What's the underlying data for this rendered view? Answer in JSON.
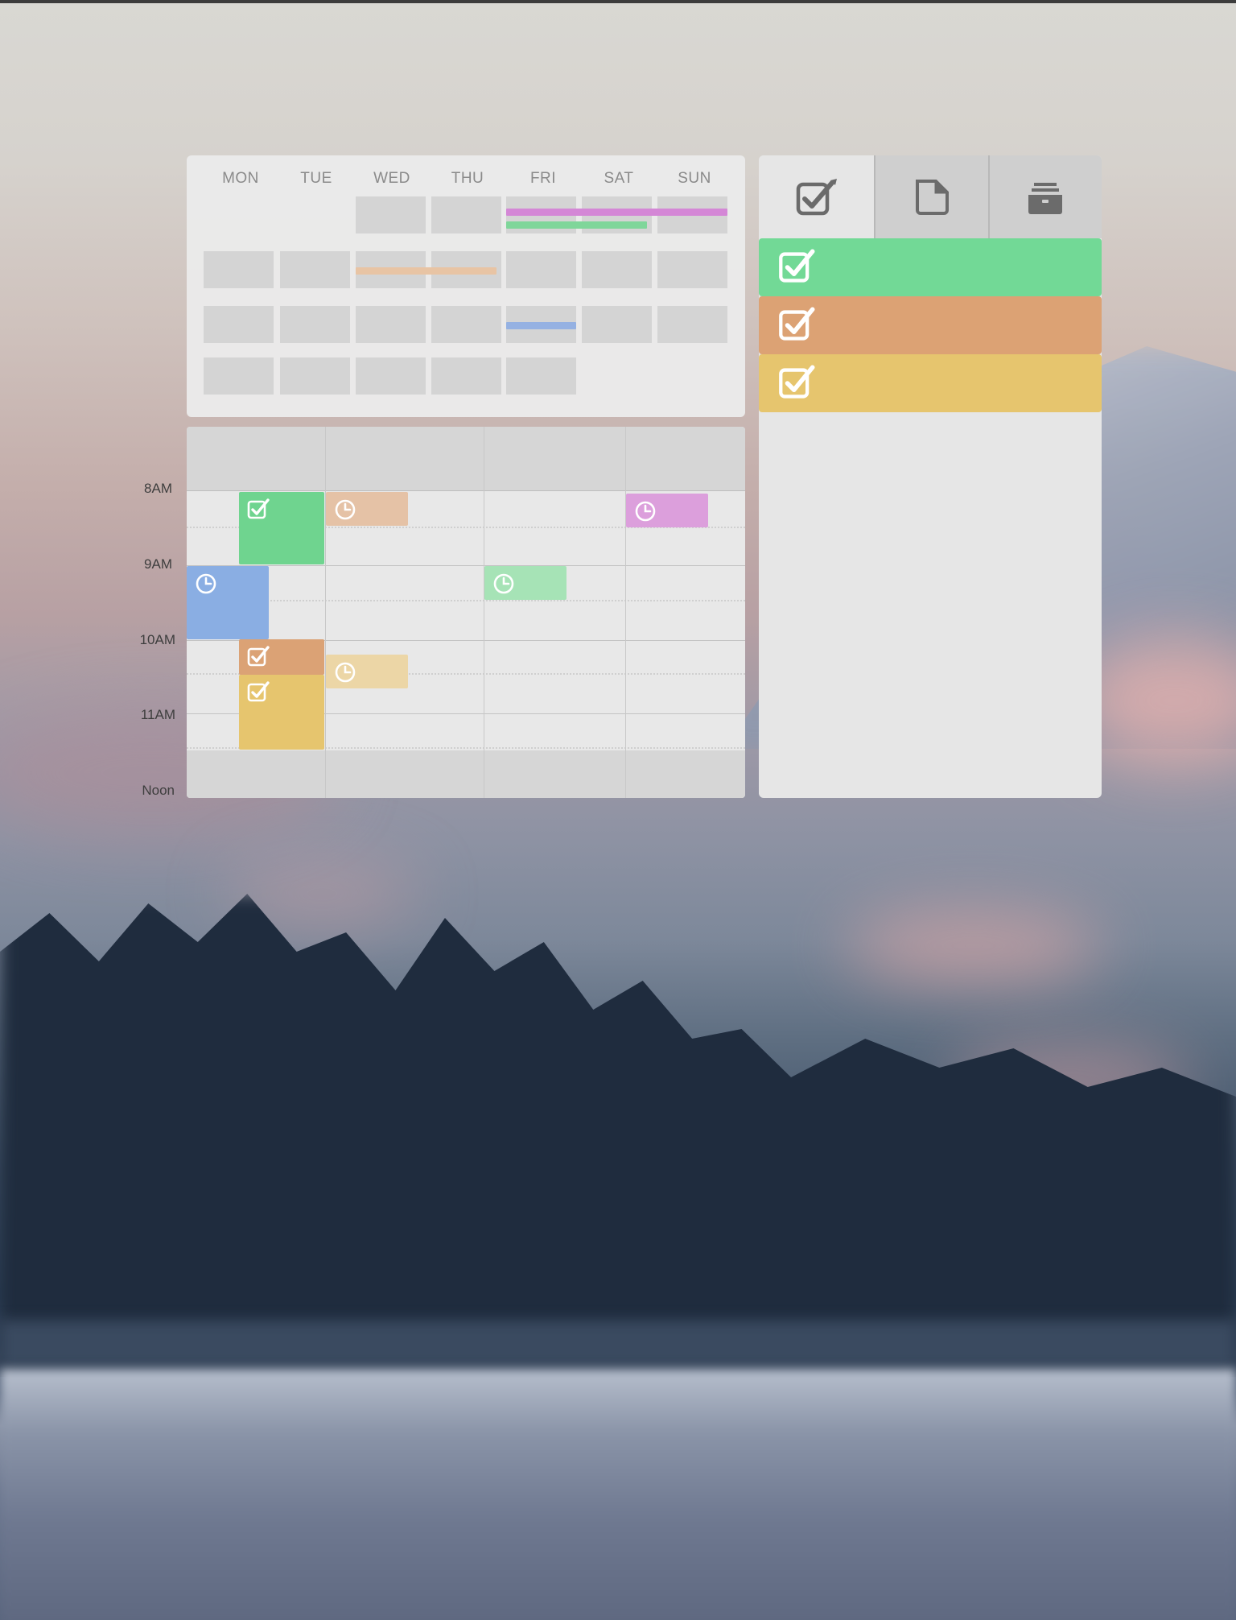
{
  "month": {
    "weekdays": [
      "MON",
      "TUE",
      "WED",
      "THU",
      "FRI",
      "SAT",
      "SUN"
    ],
    "span_events": [
      {
        "color": "#d487d6"
      },
      {
        "color": "#7fd69a"
      },
      {
        "color": "#e8c4a4"
      },
      {
        "color": "#95b1e2"
      }
    ]
  },
  "week": {
    "hours": [
      "8AM",
      "9AM",
      "10AM",
      "11AM",
      "Noon"
    ],
    "events": [
      {
        "kind": "task",
        "color": "#6fd48f",
        "icon": "checkbox-icon"
      },
      {
        "kind": "appointment",
        "color": "#e5c2a6",
        "icon": "clock-icon"
      },
      {
        "kind": "appointment",
        "color": "#dc9fdc",
        "icon": "clock-icon"
      },
      {
        "kind": "appointment",
        "color": "#8aaee3",
        "icon": "clock-icon"
      },
      {
        "kind": "appointment",
        "color": "#a6e3b6",
        "icon": "clock-icon"
      },
      {
        "kind": "task",
        "color": "#dba275",
        "icon": "checkbox-icon"
      },
      {
        "kind": "appointment",
        "color": "#ecd6a6",
        "icon": "clock-icon"
      },
      {
        "kind": "task",
        "color": "#e6c56e",
        "icon": "checkbox-icon"
      }
    ]
  },
  "tasks": {
    "tabs": [
      {
        "icon": "checkbox-edit-icon"
      },
      {
        "icon": "note-icon"
      },
      {
        "icon": "archive-icon"
      }
    ],
    "items": [
      {
        "color": "#72d996",
        "icon": "checkbox-icon"
      },
      {
        "color": "#dca274",
        "icon": "checkbox-icon"
      },
      {
        "color": "#e6c56e",
        "icon": "checkbox-icon"
      }
    ]
  }
}
